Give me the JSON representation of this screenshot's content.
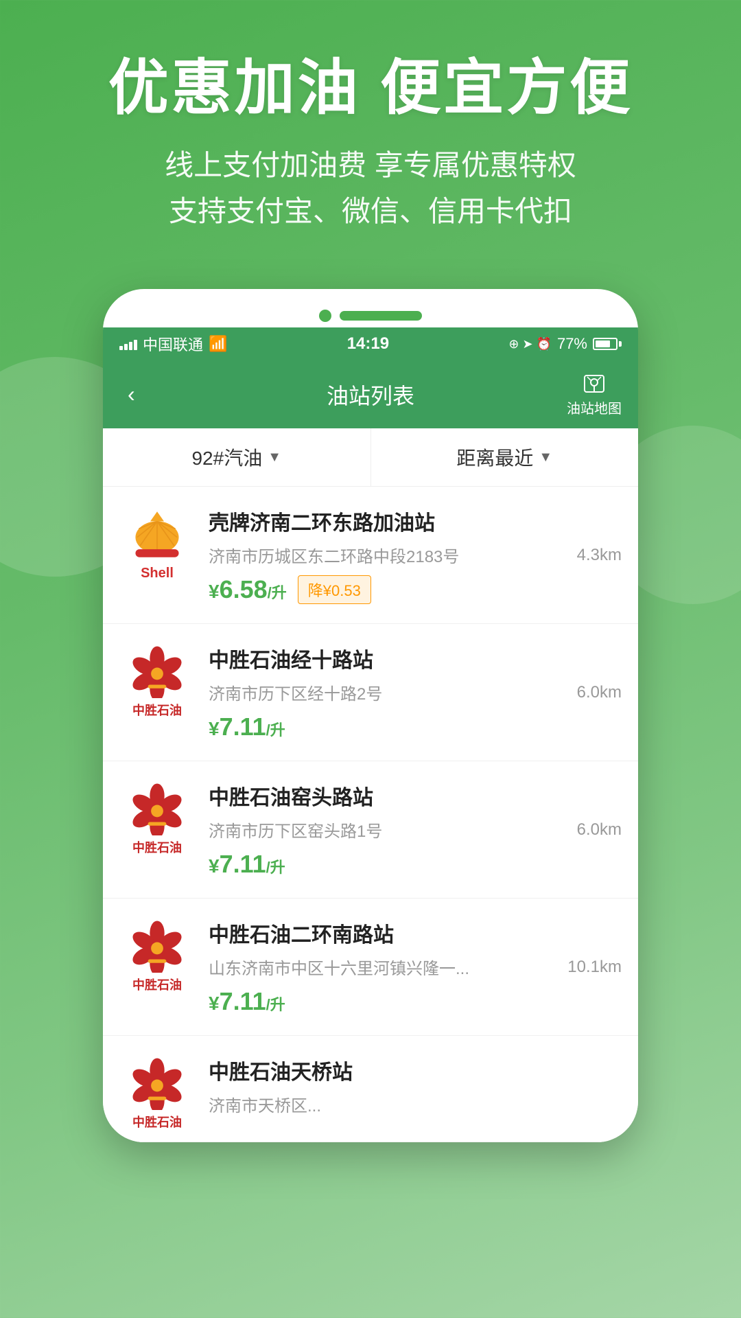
{
  "hero": {
    "title": "优惠加油 便宜方便",
    "subtitle_line1": "线上支付加油费 享专属优惠特权",
    "subtitle_line2": "支持支付宝、微信、信用卡代扣"
  },
  "phone": {
    "camera_dot": "",
    "speaker_bar": "",
    "status": {
      "carrier": "中国联通",
      "time": "14:19",
      "battery": "77%"
    },
    "navbar": {
      "back": "‹",
      "title": "油站列表",
      "map_label": "油站地图"
    },
    "filter": {
      "fuel_type": "92#汽油",
      "sort": "距离最近"
    },
    "stations": [
      {
        "name": "壳牌济南二环东路加油站",
        "address": "济南市历城区东二环路中段2183号",
        "distance": "4.3km",
        "price": "6.58",
        "unit": "/升",
        "discount": "降¥0.53",
        "logo_type": "shell"
      },
      {
        "name": "中胜石油经十路站",
        "address": "济南市历下区经十路2号",
        "distance": "6.0km",
        "price": "7.11",
        "unit": "/升",
        "discount": "",
        "logo_type": "zhongsheng"
      },
      {
        "name": "中胜石油窑头路站",
        "address": "济南市历下区窑头路1号",
        "distance": "6.0km",
        "price": "7.11",
        "unit": "/升",
        "discount": "",
        "logo_type": "zhongsheng"
      },
      {
        "name": "中胜石油二环南路站",
        "address": "山东济南市中区十六里河镇兴隆一...",
        "distance": "10.1km",
        "price": "7.11",
        "unit": "/升",
        "discount": "",
        "logo_type": "zhongsheng"
      },
      {
        "name": "中胜石油天桥站",
        "address": "济南市天桥区...",
        "distance": "",
        "price": "",
        "unit": "",
        "discount": "",
        "logo_type": "zhongsheng"
      }
    ]
  }
}
